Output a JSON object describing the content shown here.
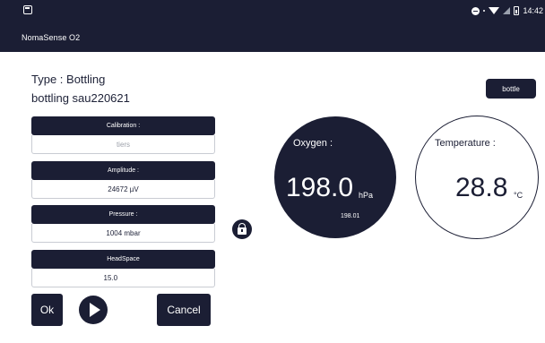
{
  "status_bar": {
    "time": "14:42",
    "colors": {
      "background": "#1b1e34"
    }
  },
  "app_bar": {
    "title": "NomaSense O2"
  },
  "measurement": {
    "type_label": "Type : Bottling",
    "name": "bottling sau220621"
  },
  "fields": {
    "calibration": {
      "label": "Calibration :",
      "value": "tiers"
    },
    "amplitude": {
      "label": "Amplitude :",
      "value": "24672 µV"
    },
    "pressure": {
      "label": "Pressure :",
      "value": "1004 mbar"
    },
    "headspace": {
      "label": "HeadSpace",
      "value": "15.0"
    }
  },
  "buttons": {
    "ok": "Ok",
    "cancel": "Cancel",
    "bottle": "bottle"
  },
  "oxygen": {
    "label": "Oxygen :",
    "value": "198.0",
    "unit": "hPa",
    "raw": "198.01"
  },
  "temperature": {
    "label": "Temperature :",
    "value": "28.8",
    "unit": "°C"
  },
  "icons": {
    "lock": "lock-icon",
    "play": "play-icon"
  },
  "colors": {
    "primary": "#1b1e34",
    "field_border": "#c9ccd3"
  }
}
